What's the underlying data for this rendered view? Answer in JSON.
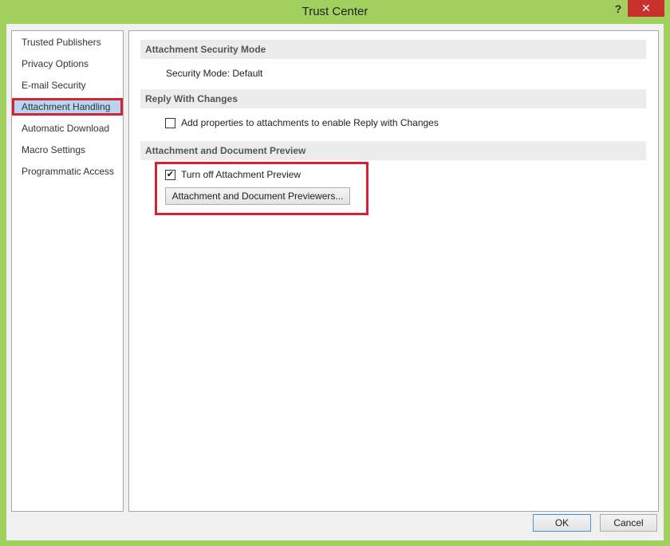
{
  "window": {
    "title": "Trust Center",
    "help_label": "?",
    "close_label": "✕"
  },
  "nav": {
    "items": [
      {
        "label": "Trusted Publishers"
      },
      {
        "label": "Privacy Options"
      },
      {
        "label": "E-mail Security"
      },
      {
        "label": "Attachment Handling",
        "selected": true
      },
      {
        "label": "Automatic Download"
      },
      {
        "label": "Macro Settings"
      },
      {
        "label": "Programmatic Access"
      }
    ]
  },
  "content": {
    "attachment_security": {
      "header": "Attachment Security Mode",
      "mode_text": "Security Mode: Default"
    },
    "reply_with_changes": {
      "header": "Reply With Changes",
      "checkbox_label": "Add properties to attachments to enable Reply with Changes",
      "checked": false
    },
    "preview": {
      "header": "Attachment and Document Preview",
      "checkbox_label": "Turn off Attachment Preview",
      "checked": true,
      "check_glyph": "✔",
      "button_label": "Attachment and Document Previewers..."
    }
  },
  "footer": {
    "ok_label": "OK",
    "cancel_label": "Cancel"
  },
  "colors": {
    "title_bar": "#a2d05f",
    "close_button": "#c9302c",
    "highlight": "#d42333",
    "nav_selected": "#b8d6f2"
  }
}
